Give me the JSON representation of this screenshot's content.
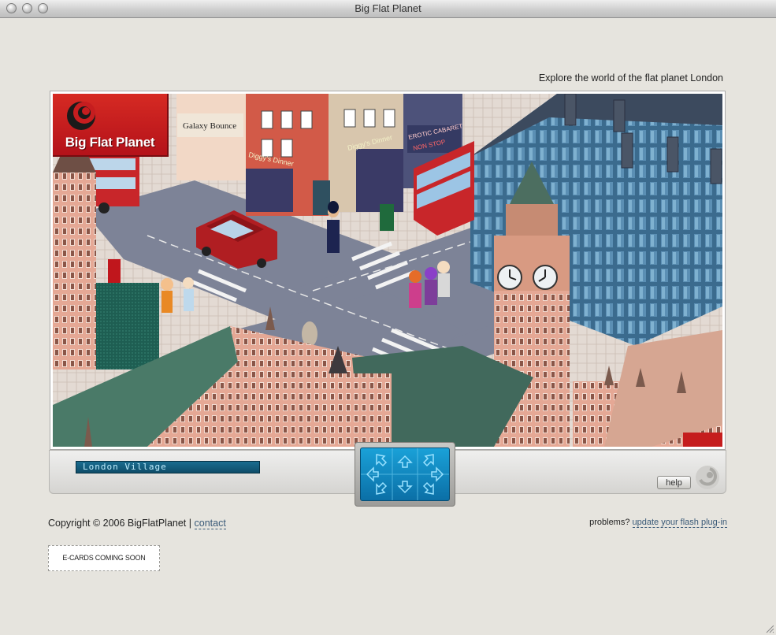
{
  "window": {
    "title": "Big Flat Planet"
  },
  "header": {
    "tagline": "Explore the world of the flat planet London"
  },
  "game": {
    "logo_text": "Big Flat Planet",
    "location_label": "London Village",
    "help_label": "help",
    "signs": {
      "galaxy": "Galaxy Bounce",
      "diggy1": "Diggy's Dinner",
      "diggy2": "Diggy's Dinner",
      "erotic": "EROTIC CABARET",
      "nonstop": "NON STOP"
    }
  },
  "footer": {
    "copyright": "Copyright © 2006 BigFlatPlanet",
    "separator": "|",
    "contact_label": "contact",
    "problems_text": "problems?",
    "flash_link": "update your flash plug-in",
    "ecards": "E-CARDS COMING SOON"
  },
  "colors": {
    "brand_red": "#c61d1f",
    "link": "#3a5a78",
    "dpad_blue": "#1591c8"
  }
}
